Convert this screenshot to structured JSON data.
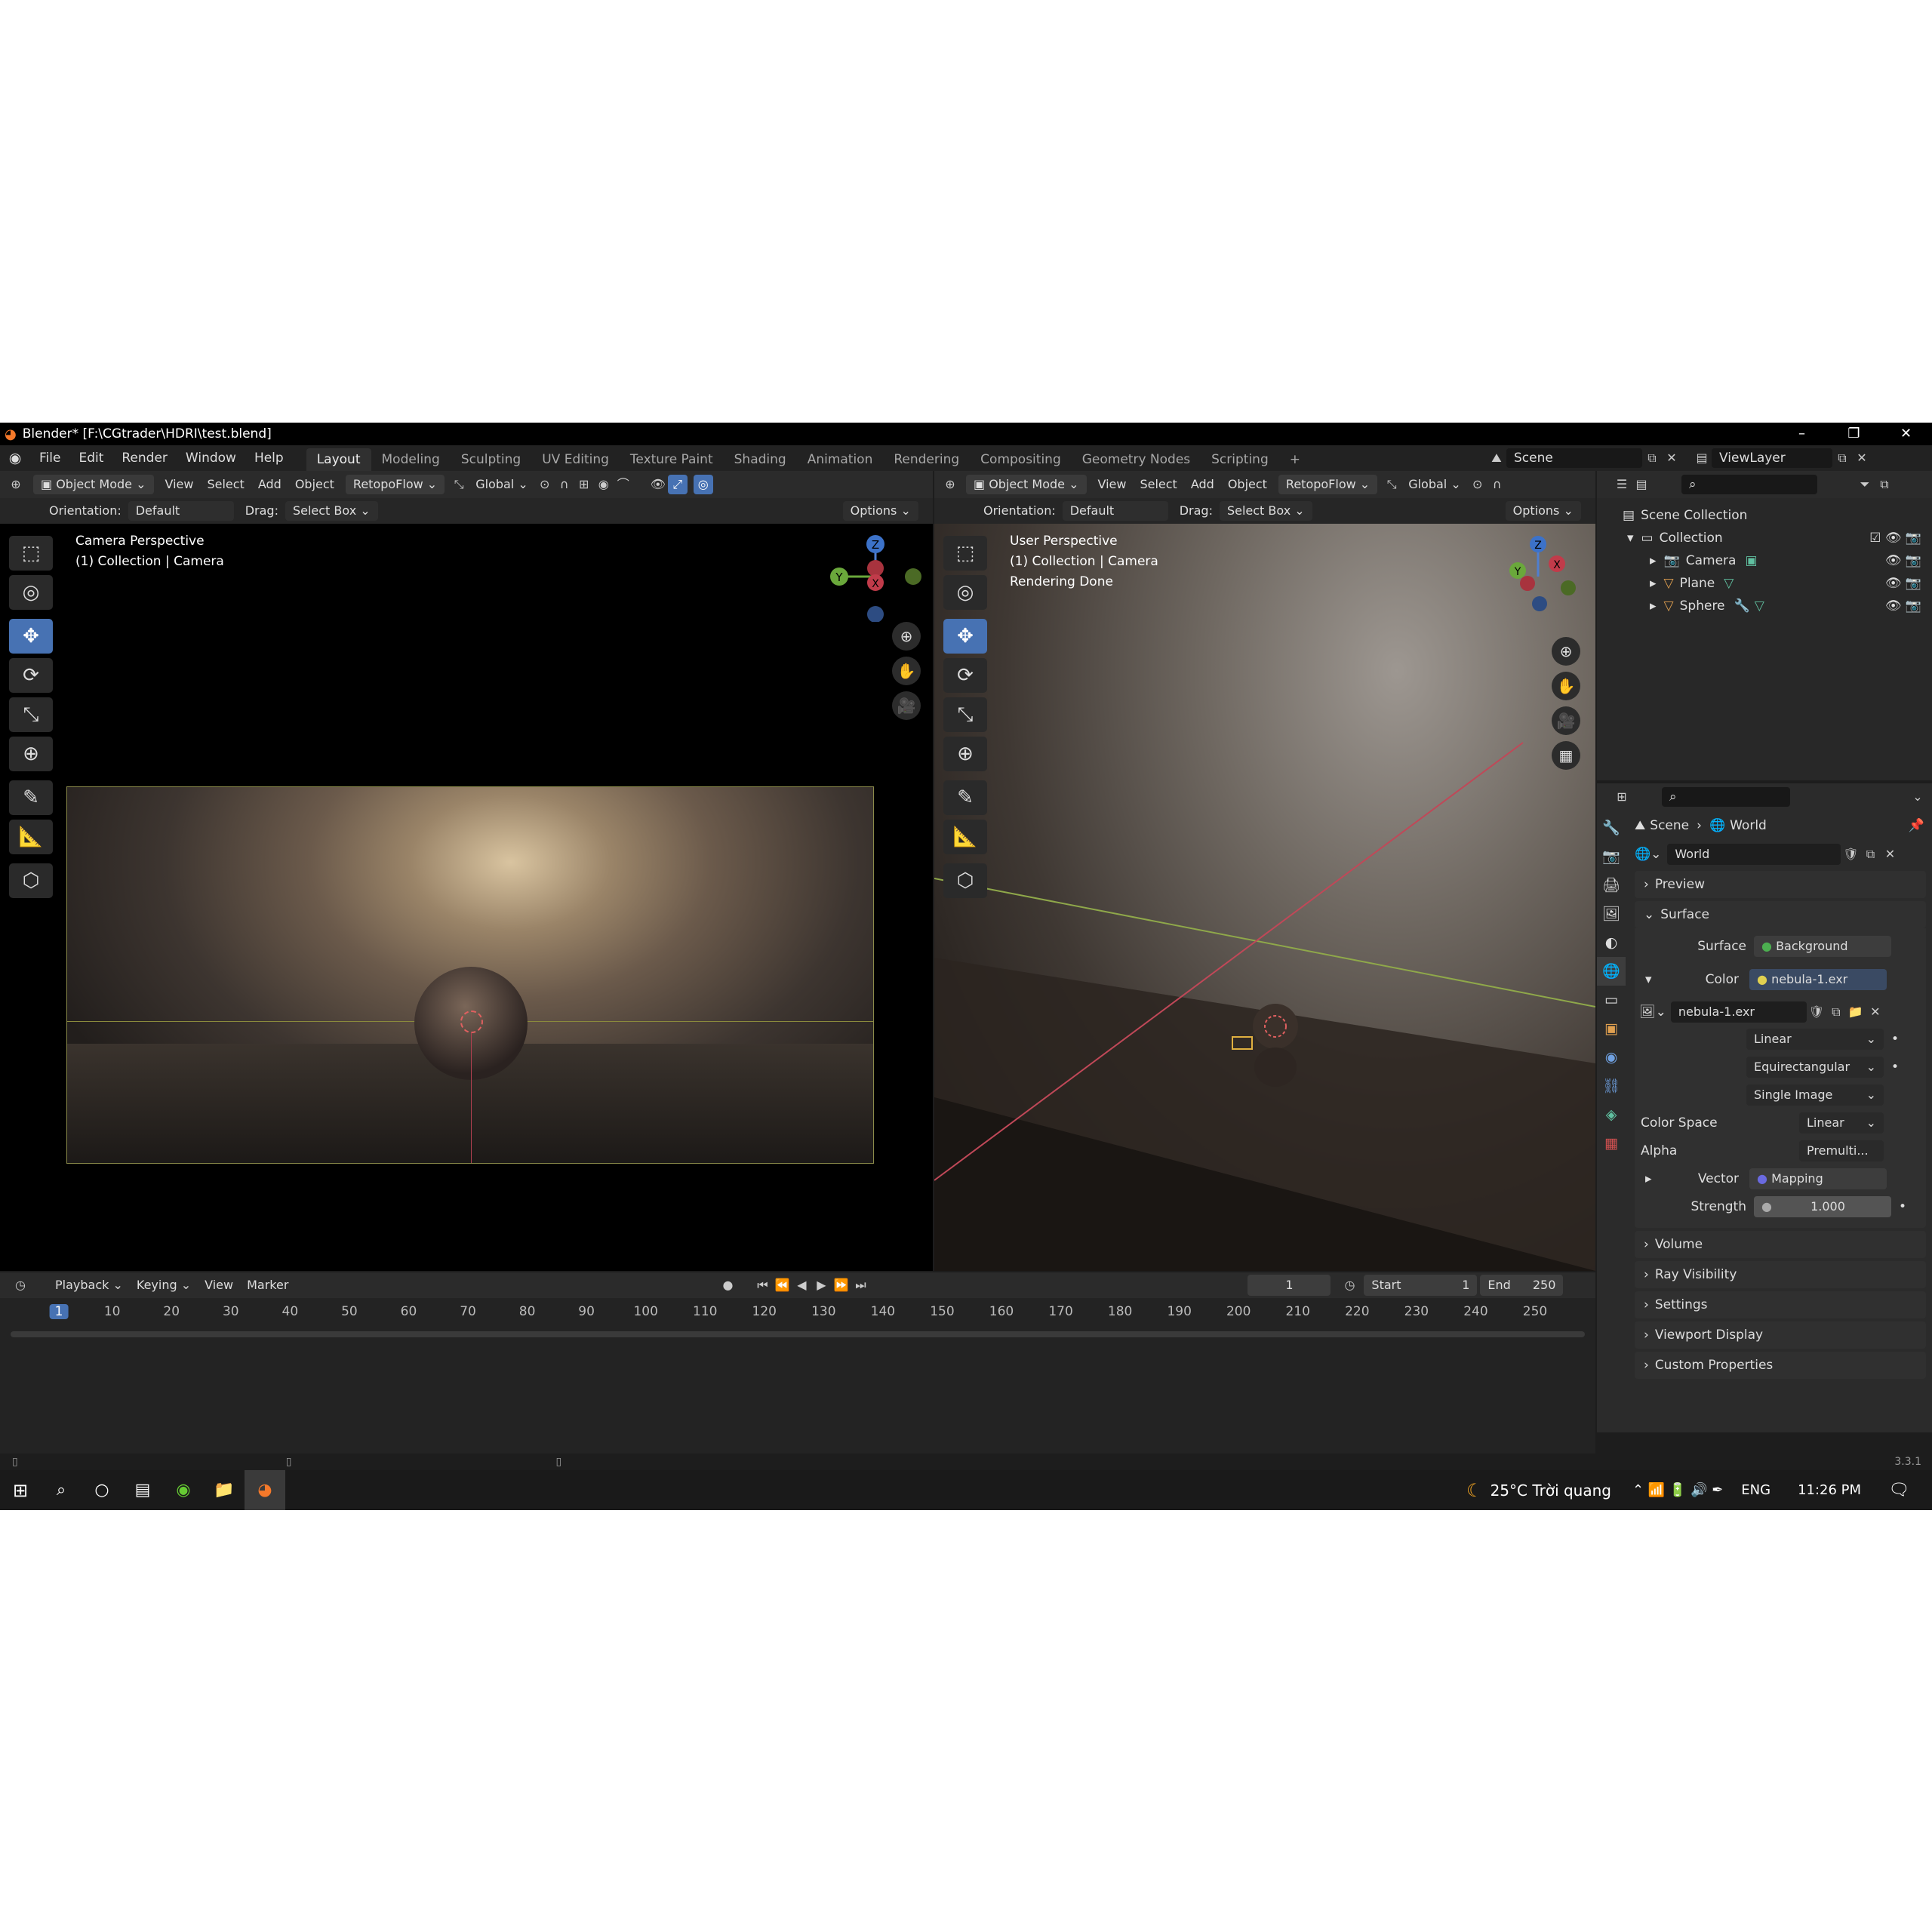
{
  "window": {
    "title": "Blender* [F:\\CGtrader\\HDRI\\test.blend]"
  },
  "menu": [
    "File",
    "Edit",
    "Render",
    "Window",
    "Help"
  ],
  "workspaces": [
    "Layout",
    "Modeling",
    "Sculpting",
    "UV Editing",
    "Texture Paint",
    "Shading",
    "Animation",
    "Rendering",
    "Compositing",
    "Geometry Nodes",
    "Scripting",
    "+"
  ],
  "scene": {
    "scene_name": "Scene",
    "viewlayer_name": "ViewLayer"
  },
  "viewport_left": {
    "mode": "Object Mode",
    "view": "View",
    "select": "Select",
    "add": "Add",
    "object": "Object",
    "addon": "RetopoFlow",
    "transform": "Global",
    "orientation_label": "Orientation:",
    "orientation_value": "Default",
    "drag_label": "Drag:",
    "drag_value": "Select Box",
    "options": "Options",
    "overlay_line1": "Camera Perspective",
    "overlay_line2": "(1) Collection | Camera"
  },
  "viewport_right": {
    "mode": "Object Mode",
    "view": "View",
    "select": "Select",
    "add": "Add",
    "object": "Object",
    "addon": "RetopoFlow",
    "transform": "Global",
    "orientation_label": "Orientation:",
    "orientation_value": "Default",
    "drag_label": "Drag:",
    "drag_value": "Select Box",
    "options": "Options",
    "overlay_line1": "User Perspective",
    "overlay_line2": "(1) Collection | Camera",
    "overlay_line3": "Rendering Done"
  },
  "gizmo": {
    "z": "Z",
    "y": "Y",
    "x": "X"
  },
  "outliner": {
    "scene_collection": "Scene Collection",
    "collection": "Collection",
    "items": [
      {
        "name": "Camera"
      },
      {
        "name": "Plane"
      },
      {
        "name": "Sphere"
      }
    ]
  },
  "properties": {
    "breadcrumb_scene": "Scene",
    "breadcrumb_world": "World",
    "world_name": "World",
    "panels": {
      "preview": "Preview",
      "surface": "Surface",
      "volume": "Volume",
      "ray_visibility": "Ray Visibility",
      "settings": "Settings",
      "viewport_display": "Viewport Display",
      "custom_properties": "Custom Properties"
    },
    "surface_label": "Surface",
    "surface_value": "Background",
    "color_label": "Color",
    "color_value": "nebula-1.exr",
    "image_name": "nebula-1.exr",
    "interp": "Linear",
    "projection": "Equirectangular",
    "source": "Single Image",
    "color_space_label": "Color Space",
    "color_space_value": "Linear",
    "alpha_label": "Alpha",
    "alpha_value": "Premulti...",
    "vector_label": "Vector",
    "vector_value": "Mapping",
    "strength_label": "Strength",
    "strength_value": "1.000"
  },
  "timeline": {
    "playback": "Playback",
    "keying": "Keying",
    "view": "View",
    "marker": "Marker",
    "current_frame": "1",
    "start_label": "Start",
    "start_value": "1",
    "end_label": "End",
    "end_value": "250",
    "ticks": [
      "1",
      "10",
      "20",
      "30",
      "40",
      "50",
      "60",
      "70",
      "80",
      "90",
      "100",
      "110",
      "120",
      "130",
      "140",
      "150",
      "160",
      "170",
      "180",
      "190",
      "200",
      "210",
      "220",
      "230",
      "240",
      "250"
    ]
  },
  "status": {
    "version": "3.3.1"
  },
  "taskbar": {
    "weather": "25°C Trời quang",
    "lang": "ENG",
    "time": "11:26 PM"
  },
  "colors": {
    "accent": "#4772b3",
    "header": "#2b2b2b",
    "panel": "#303030",
    "field": "#545454"
  }
}
